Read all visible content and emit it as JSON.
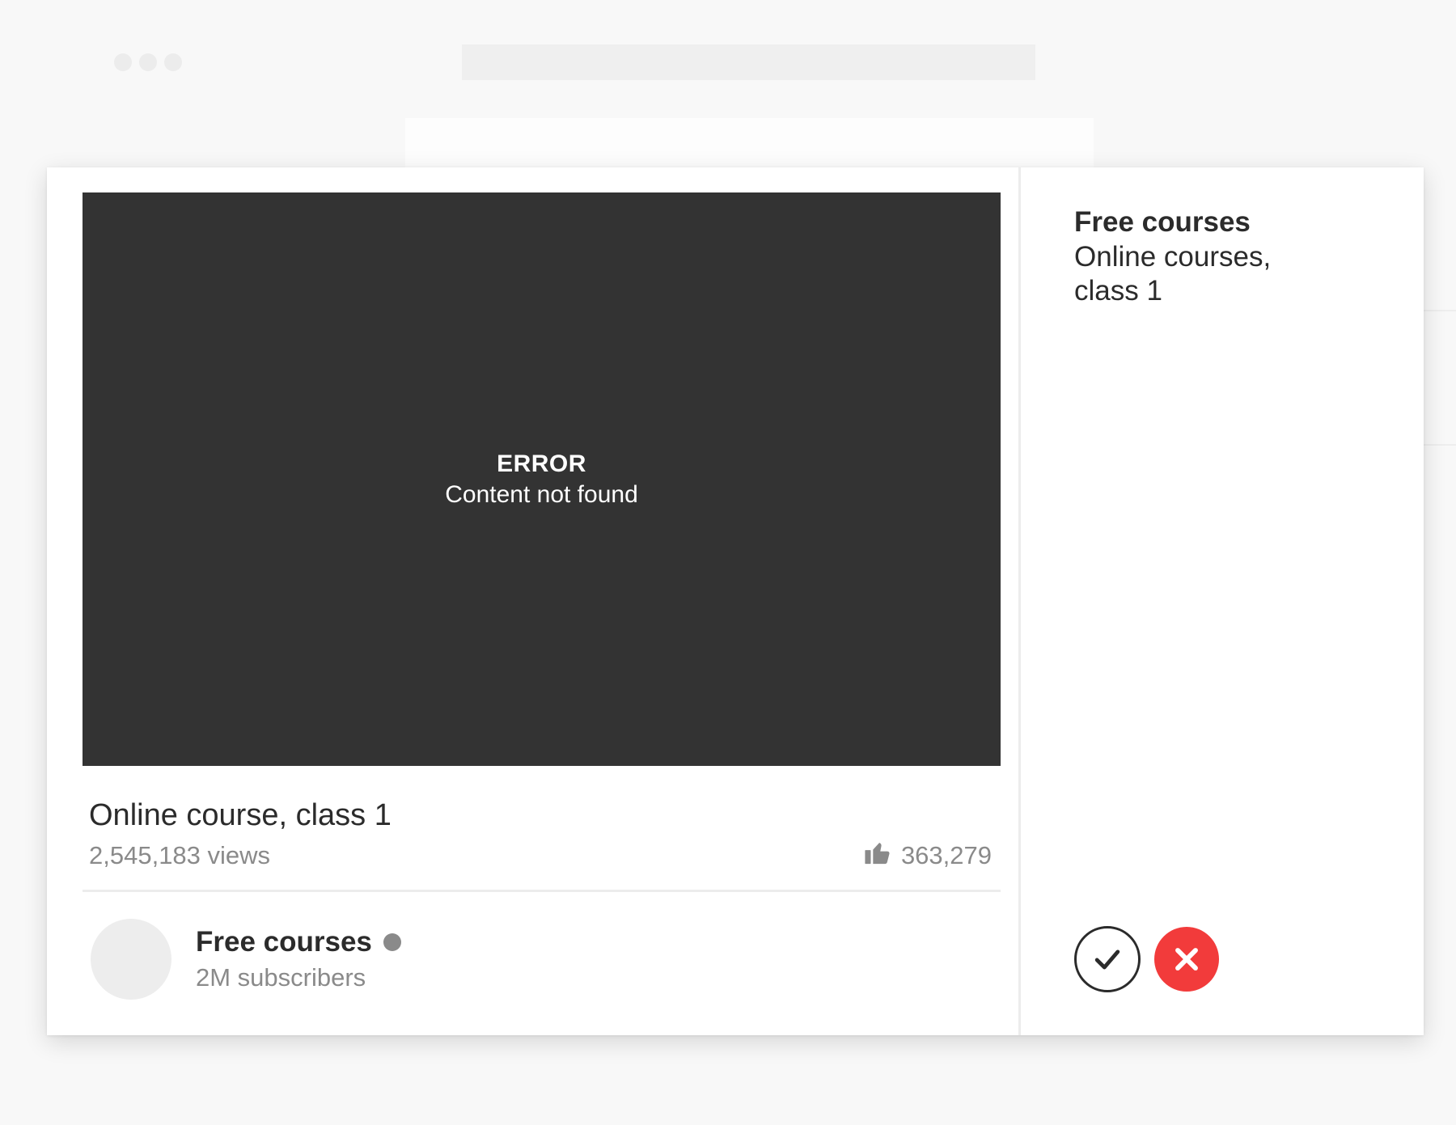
{
  "browser": {
    "dots_icon": "window-controls-icon"
  },
  "video": {
    "error_title": "ERROR",
    "error_message": "Content not found"
  },
  "details": {
    "title": "Online course, class 1",
    "views": "2,545,183 views",
    "likes": "363,279",
    "like_icon": "thumbs-up-icon"
  },
  "channel": {
    "name": "Free courses",
    "subscribers": "2M subscribers"
  },
  "side_panel": {
    "title": "Free courses",
    "subtitle": "Online courses, class 1"
  },
  "actions": {
    "confirm_icon": "checkmark-icon",
    "cancel_icon": "close-icon",
    "cancel_color": "#f23b3b"
  }
}
